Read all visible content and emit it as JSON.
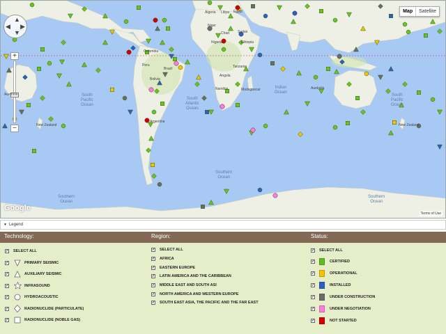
{
  "map": {
    "map_type_options": [
      "Map",
      "Satellite"
    ],
    "selected_map_type": "Map",
    "logo": "Google",
    "terms": "Terms of Use",
    "ocean_labels": [
      [
        "South",
        "Pacific",
        "Ocean"
      ],
      [
        "South",
        "Atlantic",
        "Ocean"
      ],
      [
        "Indian",
        "Ocean"
      ],
      [
        "South",
        "Pacific",
        "Ocean"
      ],
      [
        "Southern",
        "Ocean"
      ],
      [
        "Southern",
        "Ocean"
      ],
      [
        "Southern",
        "Ocean"
      ]
    ],
    "country_labels": [
      "Algeria",
      "Libya",
      "Egypt",
      "Niger",
      "Chad",
      "Sudan",
      "Nigeria",
      "Ethiopia",
      "Tanzania",
      "Angola",
      "Namibia",
      "Madagascar",
      "Peru",
      "Brazil",
      "Colombia",
      "Bolivia",
      "Argentina",
      "Australia",
      "New Zealand"
    ]
  },
  "legend": {
    "toggle_label": "Legend",
    "technology": {
      "header": "Technology:",
      "items": [
        "SELECT ALL",
        "PRIMARY SEISMIC",
        "AUXILIARY SEISMIC",
        "INFRASOUND",
        "HYDROACOUSTIC",
        "RADIONUCLIDE (PARTICULATE)",
        "RADIONUCLIDE (NOBLE GAS)"
      ],
      "icons": [
        "none",
        "triangle-down-icon",
        "triangle-up-icon",
        "star-icon",
        "circle-icon",
        "diamond-icon",
        "square-icon"
      ]
    },
    "region": {
      "header": "Region:",
      "items": [
        "SELECT ALL",
        "AFRICA",
        "EASTERN EUROPE",
        "LATIN AMERICA AND THE CARIBBEAN",
        "MIDDLE EAST AND SOUTH ASI",
        "NORTH AMERICA AND WESTERN EUROPE",
        "SOUTH EAST ASIA, THE PACIFIC AND THE FAR EAST"
      ]
    },
    "status": {
      "header": "Status:",
      "items": [
        {
          "label": "SELECT ALL",
          "color": ""
        },
        {
          "label": "CERTIFIED",
          "color": "#5cbf1f"
        },
        {
          "label": "OPERATIONAL",
          "color": "#f5c400"
        },
        {
          "label": "INSTALLED",
          "color": "#2d5fc4"
        },
        {
          "label": "UNDER CONSTRUCTION",
          "color": "#6b6b6b"
        },
        {
          "label": "UNDER NEGOTIATION",
          "color": "#ff7ddc"
        },
        {
          "label": "NOT STARTED",
          "color": "#d40000"
        }
      ]
    }
  }
}
